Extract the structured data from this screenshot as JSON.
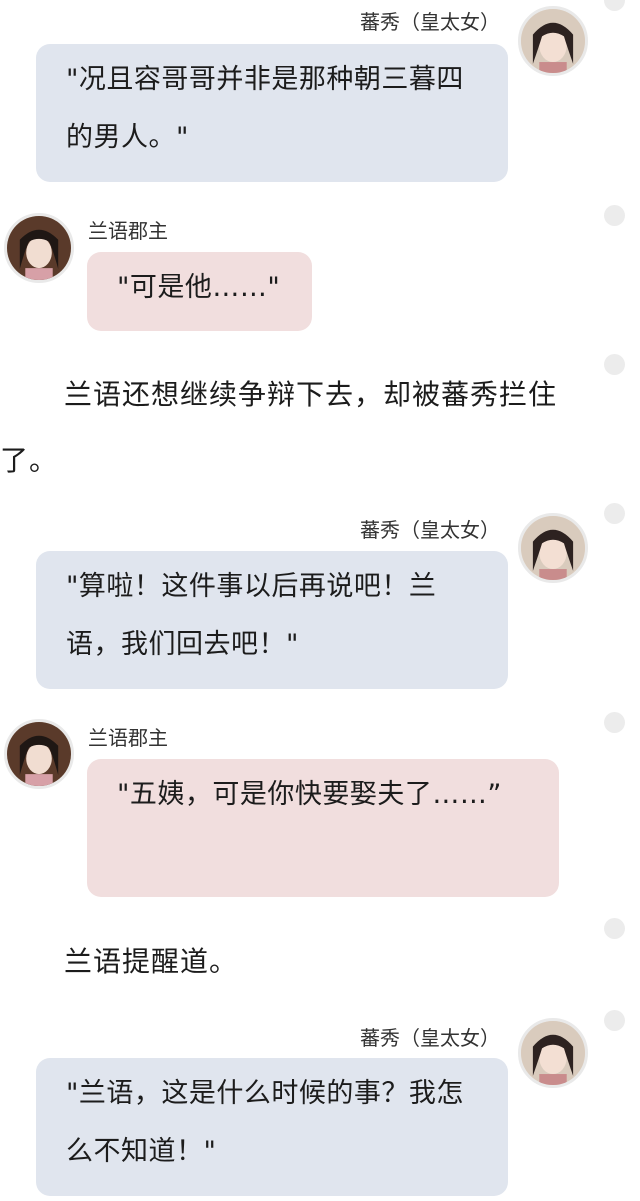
{
  "messages": [
    {
      "speaker": "蕃秀（皇太女）",
      "text": "\"况且容哥哥并非是那种朝三暮四的男人。\""
    },
    {
      "speaker": "兰语郡主",
      "text": "\"可是他……\""
    },
    {
      "narration": "兰语还想继续争辩下去，却被蕃秀拦住了。"
    },
    {
      "speaker": "蕃秀（皇太女）",
      "text": "\"算啦！这件事以后再说吧！兰语，我们回去吧！\""
    },
    {
      "speaker": "兰语郡主",
      "text": "\"五姨，可是你快要娶夫了……”"
    },
    {
      "narration": "兰语提醒道。"
    },
    {
      "speaker": "蕃秀（皇太女）",
      "text": "\"兰语，这是什么时候的事？我怎么不知道！\""
    }
  ],
  "colors": {
    "right_bubble": "#e0e5ee",
    "left_bubble": "#f1dede",
    "dot": "#ececec"
  },
  "icons": [
    "avatar-xiuxiu",
    "avatar-lanyu",
    "message-dot"
  ]
}
